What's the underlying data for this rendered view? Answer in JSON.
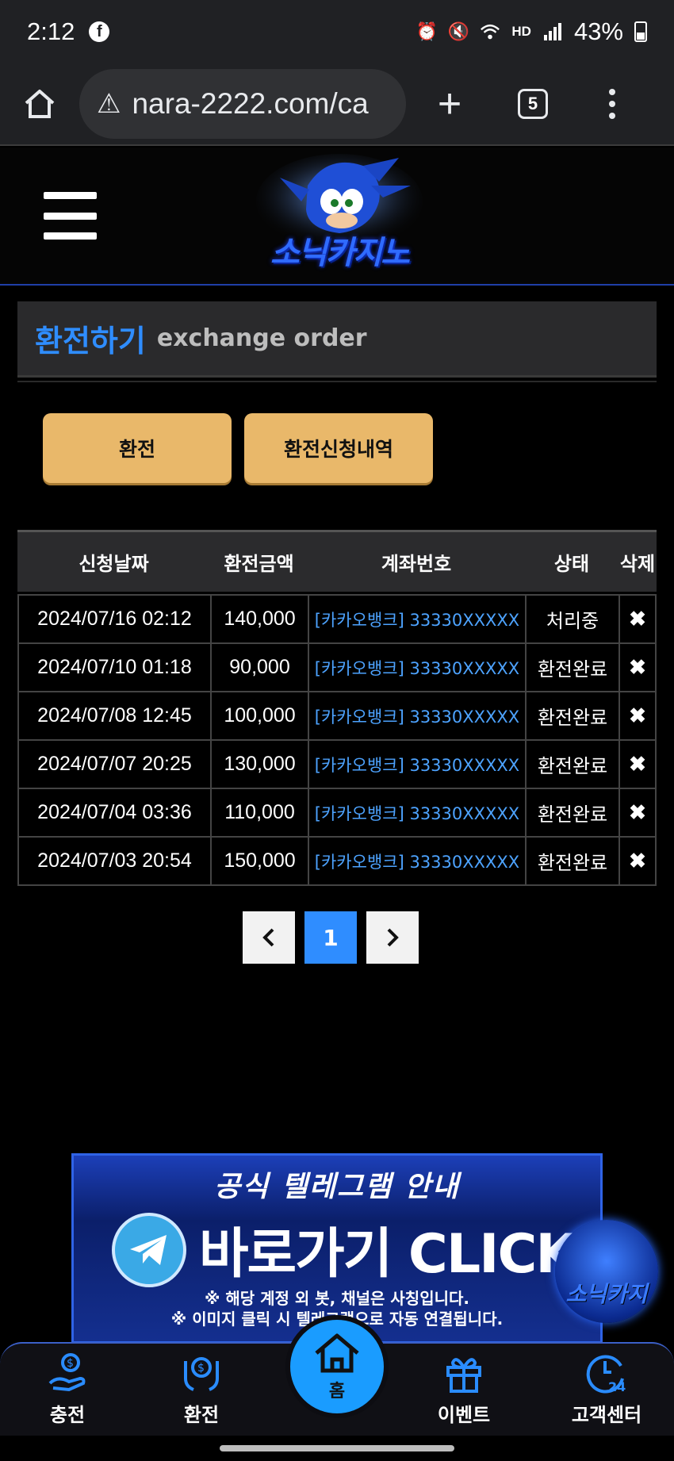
{
  "status_bar": {
    "time": "2:12",
    "hd_label": "HD",
    "battery": "43%"
  },
  "browser": {
    "url": "nara-2222.com/ca",
    "tab_count": "5"
  },
  "site": {
    "logo_text": "소닉카지노"
  },
  "section": {
    "title_ko": "환전하기",
    "title_en": "exchange order"
  },
  "buttons": {
    "exchange": "환전",
    "history": "환전신청내역"
  },
  "table": {
    "headers": [
      "신청날짜",
      "환전금액",
      "계좌번호",
      "상태",
      "삭제"
    ],
    "rows": [
      {
        "date": "2024/07/16 02:12",
        "amount": "140,000",
        "account": "[카카오뱅크] 33330XXXXX",
        "status": "처리중",
        "delete": "✖"
      },
      {
        "date": "2024/07/10 01:18",
        "amount": "90,000",
        "account": "[카카오뱅크] 33330XXXXX",
        "status": "환전완료",
        "delete": "✖"
      },
      {
        "date": "2024/07/08 12:45",
        "amount": "100,000",
        "account": "[카카오뱅크] 33330XXXXX",
        "status": "환전완료",
        "delete": "✖"
      },
      {
        "date": "2024/07/07 20:25",
        "amount": "130,000",
        "account": "[카카오뱅크] 33330XXXXX",
        "status": "환전완료",
        "delete": "✖"
      },
      {
        "date": "2024/07/04 03:36",
        "amount": "110,000",
        "account": "[카카오뱅크] 33330XXXXX",
        "status": "환전완료",
        "delete": "✖"
      },
      {
        "date": "2024/07/03 20:54",
        "amount": "150,000",
        "account": "[카카오뱅크] 33330XXXXX",
        "status": "환전완료",
        "delete": "✖"
      }
    ]
  },
  "pagination": {
    "prev": "‹",
    "current": "1",
    "next": "›"
  },
  "banner": {
    "title": "공식 텔레그램 안내",
    "cta": "바로가기 CLICK",
    "note1": "※ 해당 계정 외 봇, 채널은 사칭입니다.",
    "note2": "※ 이미지 클릭 시 텔레그램으로 자동 연결됩니다.",
    "badge_text": "소닉카지"
  },
  "bottom_nav": {
    "charge": "충전",
    "exchange": "환전",
    "home": "홈",
    "event": "이벤트",
    "support": "고객센터"
  },
  "colors": {
    "accent_blue": "#2f8dff",
    "button_gold": "#e9b86a",
    "account_blue": "#4da3ff"
  }
}
